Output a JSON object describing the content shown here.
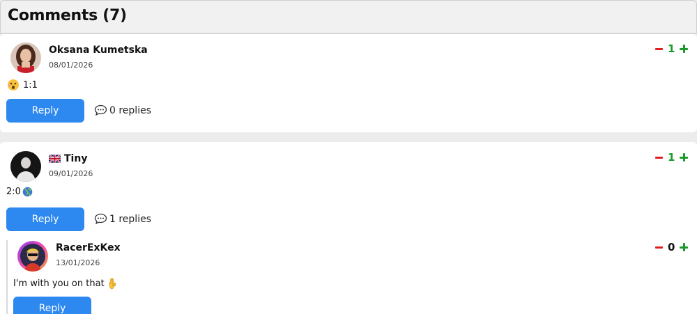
{
  "header": {
    "title": "Comments (7)"
  },
  "colors": {
    "reply_button": "#2d88f0",
    "vote_up": "#1a9a2a",
    "vote_down": "#e02020",
    "score_positive": "#1a9a2a"
  },
  "comments": [
    {
      "author": "Oksana Kumetska",
      "date": "08/01/2026",
      "text": "1:1",
      "text_icon": "surprised-face-emoji",
      "reply_label": "Reply",
      "replies_label": "0 replies",
      "score": "1"
    },
    {
      "author": "Tiny",
      "author_flag": "uk-flag-icon",
      "date": "09/01/2026",
      "text": "2:0",
      "text_icon": "globe-emoji",
      "reply_label": "Reply",
      "replies_label": "1 replies",
      "score": "1",
      "replies": [
        {
          "author": "RacerExKex",
          "date": "13/01/2026",
          "text": "I'm with you on that",
          "text_icon": "ok-hand-emoji",
          "reply_label": "Reply",
          "score": "0"
        }
      ]
    }
  ]
}
